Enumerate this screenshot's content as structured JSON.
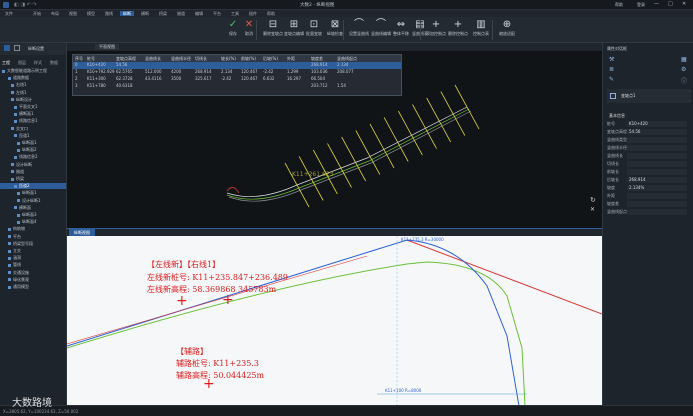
{
  "title": "大数2 - 纵断视图",
  "window_controls": [
    "—",
    "□",
    "✕"
  ],
  "user": {
    "help": "帮助",
    "account": "登录"
  },
  "menu": [
    "文件",
    "开始",
    "布局",
    "视图",
    "模型",
    "路线",
    "纵断",
    "横断",
    "桥梁",
    "隧道",
    "编辑",
    "平台",
    "工具",
    "插件",
    "帮助"
  ],
  "menu_active_index": 6,
  "ribbon_buttons": [
    {
      "label": "保存",
      "glyph": "✓"
    },
    {
      "label": "取消",
      "glyph": "✕"
    },
    {
      "label": "删除变坡点",
      "glyph": "⊟"
    },
    {
      "label": "变坡点编辑",
      "glyph": "⊞"
    },
    {
      "label": "批量变坡",
      "glyph": "⊡"
    },
    {
      "label": "纵坡检查",
      "glyph": "⊠"
    },
    {
      "label": "设置竖曲线",
      "glyph": "⌒"
    },
    {
      "label": "竖曲线编辑",
      "glyph": "⌒"
    },
    {
      "label": "整体平移",
      "glyph": "⇔"
    },
    {
      "label": "竖曲线表",
      "glyph": "▤"
    },
    {
      "label": "添加控制点",
      "glyph": "+"
    },
    {
      "label": "删除控制点",
      "glyph": "+"
    },
    {
      "label": "控制点表",
      "glyph": "▥"
    },
    {
      "label": "缩放适配",
      "glyph": "⊕"
    }
  ],
  "left_panel": {
    "header": "纵断设置",
    "tabs": [
      "工程",
      "图层",
      "样式",
      "数据"
    ],
    "tree": [
      "大数智能道路示例工程",
      "道路数据",
      "右线1",
      "左线1",
      "纵断设计",
      "平面交叉1",
      "横断面1",
      "线路信息1",
      "交叉口",
      "匝道1",
      "纵断面1",
      "纵断面2",
      "线路信息2",
      "设计纵断",
      "隧道",
      "桥梁",
      "匝道2",
      "纵断面1",
      "设计纵断1",
      "横断面",
      "纵断面3",
      "纵断面4",
      "构筑物",
      "平台",
      "桥梁型号段",
      "立交",
      "涵洞",
      "管线",
      "交通设施",
      "绿化景观",
      "通用模型"
    ],
    "tree_selected_index": 16
  },
  "top_table": {
    "tab": "平面视图",
    "headers": [
      "序号",
      "桩号",
      "变坡点高程",
      "竖曲线长",
      "竖曲线半径",
      "切线长",
      "坡长(%)",
      "前坡(%)",
      "后坡(%)",
      "外距",
      "坡度差",
      "竖曲线起点"
    ],
    "rows": [
      [
        "0",
        "K10+420",
        "54.56",
        "",
        "",
        "",
        "",
        "",
        "",
        "",
        "268.914",
        "2.134"
      ],
      [
        "1",
        "K10+792.929",
        "62.5765",
        "512.000",
        "4200",
        "268.914",
        "2.134",
        "120.467",
        "-2.42",
        "1.299",
        "103.036",
        "208.077"
      ],
      [
        "2",
        "K11+300",
        "62.3728",
        "43.4116",
        "3500",
        "325.617",
        "-2.42",
        "120.467",
        "6.632",
        "16.297",
        "66.504",
        ""
      ],
      [
        "3",
        "K11+780",
        "40.6318",
        "",
        "",
        "",
        "",
        "",
        "",
        "",
        "203.712",
        "1.54"
      ]
    ]
  },
  "plan_label": "K11+261.623",
  "bottom_view": {
    "tab": "纵断视图",
    "peak_label": "K11+235.3 R=30000",
    "bottom_label": "K11+100 R=8000"
  },
  "annotations": {
    "main_line_title": "【左线新】【右线1】",
    "main_stake": "左线新桩号: K11+235.847+236.489",
    "main_elev": "左线新高程: 58.369868 345783m",
    "aux_title": "【辅路】",
    "aux_stake": "辅路桩号: K11+235.3",
    "aux_elev": "辅路高程: 50.044425m"
  },
  "right_panel": {
    "header": "属性对话框",
    "object_name": "变坡点1",
    "section": "基本信息",
    "props": [
      [
        "桩号",
        "K10+420"
      ],
      [
        "变坡点高程",
        "54.56"
      ],
      [
        "竖曲线类型",
        ""
      ],
      [
        "竖曲线半径",
        ""
      ],
      [
        "竖曲线长",
        ""
      ],
      [
        "切线长",
        ""
      ],
      [
        "前坡长",
        ""
      ],
      [
        "后坡长",
        "268.914"
      ],
      [
        "坡度",
        "2.134%"
      ],
      [
        "外距",
        ""
      ],
      [
        "坡度差",
        ""
      ],
      [
        "竖曲线起点",
        ""
      ]
    ]
  },
  "status": {
    "coords": "X=2805.62, Y=100234.63, Z=50.002",
    "watermark": "大数路境"
  },
  "colors": {
    "accent": "#2d5d9a",
    "annotation_red": "#e01b1b",
    "design_line": "#2b5fd6",
    "ground_line": "#6bbf3a",
    "slope_line": "#d83a3a"
  }
}
